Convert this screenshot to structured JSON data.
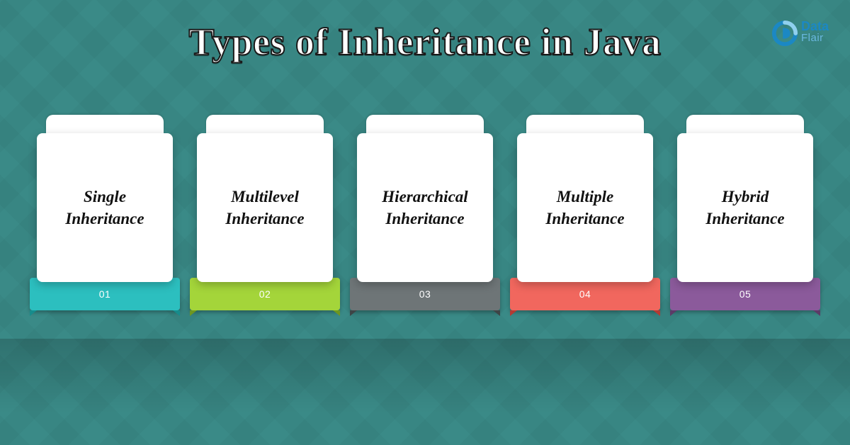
{
  "title": "Types of Inheritance in Java",
  "logo": {
    "line1": "Data",
    "line2": "Flair"
  },
  "cards": [
    {
      "label": "Single Inheritance",
      "number": "01",
      "color": "#2cbfbf"
    },
    {
      "label": "Multilevel Inheritance",
      "number": "02",
      "color": "#a4d53a"
    },
    {
      "label": "Hierarchical Inheritance",
      "number": "03",
      "color": "#6e7577"
    },
    {
      "label": "Multiple Inheritance",
      "number": "04",
      "color": "#f1675e"
    },
    {
      "label": "Hybrid Inheritance",
      "number": "05",
      "color": "#8b5a9b"
    }
  ]
}
